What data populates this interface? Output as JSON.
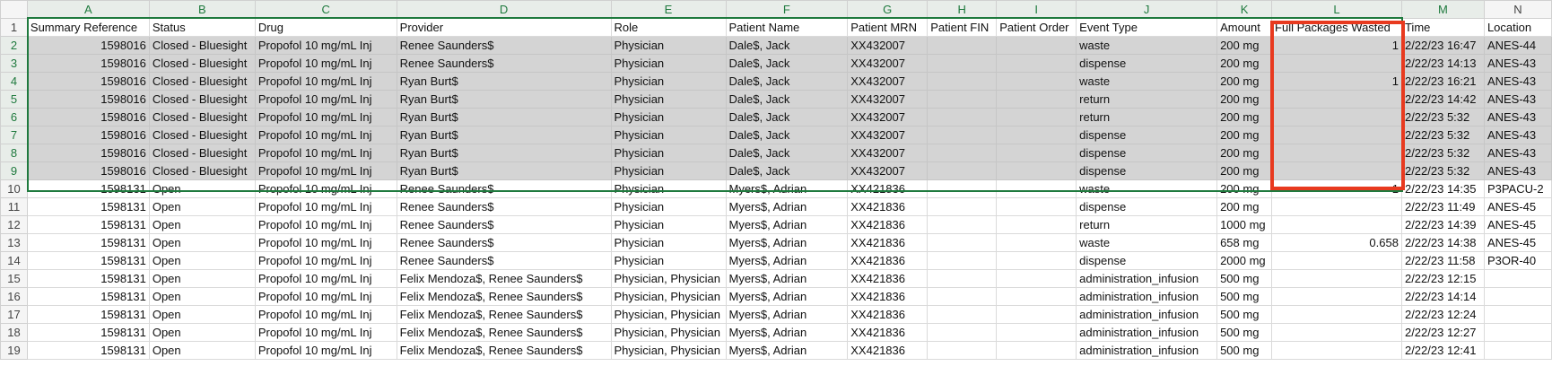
{
  "columns": [
    {
      "letter": "A",
      "num": false
    },
    {
      "letter": "B",
      "num": false
    },
    {
      "letter": "C",
      "num": false
    },
    {
      "letter": "D",
      "num": false
    },
    {
      "letter": "E",
      "num": false
    },
    {
      "letter": "F",
      "num": false
    },
    {
      "letter": "G",
      "num": false
    },
    {
      "letter": "H",
      "num": false
    },
    {
      "letter": "I",
      "num": false
    },
    {
      "letter": "J",
      "num": false
    },
    {
      "letter": "K",
      "num": false
    },
    {
      "letter": "L",
      "num": false
    },
    {
      "letter": "M",
      "num": false
    },
    {
      "letter": "N",
      "num": false
    }
  ],
  "header_row": [
    "Summary Reference",
    "Status",
    "Drug",
    "Provider",
    "Role",
    "Patient Name",
    "Patient MRN",
    "Patient FIN",
    "Patient Order",
    "Event Type",
    "Amount",
    "Full Packages Wasted",
    "Time",
    "Location"
  ],
  "rows": [
    {
      "n": "2",
      "cells": [
        "1598016",
        "Closed - Bluesight",
        "Propofol 10 mg/mL Inj",
        "Renee Saunders$",
        "Physician",
        "Dale$, Jack",
        "XX432007",
        "",
        "",
        "waste",
        "200 mg",
        "1",
        "2/22/23 16:47",
        "ANES-44"
      ]
    },
    {
      "n": "3",
      "cells": [
        "1598016",
        "Closed - Bluesight",
        "Propofol 10 mg/mL Inj",
        "Renee Saunders$",
        "Physician",
        "Dale$, Jack",
        "XX432007",
        "",
        "",
        "dispense",
        "200 mg",
        "",
        "2/22/23 14:13",
        "ANES-43"
      ]
    },
    {
      "n": "4",
      "cells": [
        "1598016",
        "Closed - Bluesight",
        "Propofol 10 mg/mL Inj",
        "Ryan Burt$",
        "Physician",
        "Dale$, Jack",
        "XX432007",
        "",
        "",
        "waste",
        "200 mg",
        "1",
        "2/22/23 16:21",
        "ANES-43"
      ]
    },
    {
      "n": "5",
      "cells": [
        "1598016",
        "Closed - Bluesight",
        "Propofol 10 mg/mL Inj",
        "Ryan Burt$",
        "Physician",
        "Dale$, Jack",
        "XX432007",
        "",
        "",
        "return",
        "200 mg",
        "",
        "2/22/23 14:42",
        "ANES-43"
      ]
    },
    {
      "n": "6",
      "cells": [
        "1598016",
        "Closed - Bluesight",
        "Propofol 10 mg/mL Inj",
        "Ryan Burt$",
        "Physician",
        "Dale$, Jack",
        "XX432007",
        "",
        "",
        "return",
        "200 mg",
        "",
        "2/22/23 5:32",
        "ANES-43"
      ]
    },
    {
      "n": "7",
      "cells": [
        "1598016",
        "Closed - Bluesight",
        "Propofol 10 mg/mL Inj",
        "Ryan Burt$",
        "Physician",
        "Dale$, Jack",
        "XX432007",
        "",
        "",
        "dispense",
        "200 mg",
        "",
        "2/22/23 5:32",
        "ANES-43"
      ]
    },
    {
      "n": "8",
      "cells": [
        "1598016",
        "Closed - Bluesight",
        "Propofol 10 mg/mL Inj",
        "Ryan Burt$",
        "Physician",
        "Dale$, Jack",
        "XX432007",
        "",
        "",
        "dispense",
        "200 mg",
        "",
        "2/22/23 5:32",
        "ANES-43"
      ]
    },
    {
      "n": "9",
      "cells": [
        "1598016",
        "Closed - Bluesight",
        "Propofol 10 mg/mL Inj",
        "Ryan Burt$",
        "Physician",
        "Dale$, Jack",
        "XX432007",
        "",
        "",
        "dispense",
        "200 mg",
        "",
        "2/22/23 5:32",
        "ANES-43"
      ]
    },
    {
      "n": "10",
      "cells": [
        "1598131",
        "Open",
        "Propofol 10 mg/mL Inj",
        "Renee Saunders$",
        "Physician",
        "Myers$, Adrian",
        "XX421836",
        "",
        "",
        "waste",
        "200 mg",
        "1",
        "2/22/23 14:35",
        "P3PACU-2"
      ]
    },
    {
      "n": "11",
      "cells": [
        "1598131",
        "Open",
        "Propofol 10 mg/mL Inj",
        "Renee Saunders$",
        "Physician",
        "Myers$, Adrian",
        "XX421836",
        "",
        "",
        "dispense",
        "200 mg",
        "",
        "2/22/23 11:49",
        "ANES-45"
      ]
    },
    {
      "n": "12",
      "cells": [
        "1598131",
        "Open",
        "Propofol 10 mg/mL Inj",
        "Renee Saunders$",
        "Physician",
        "Myers$, Adrian",
        "XX421836",
        "",
        "",
        "return",
        "1000 mg",
        "",
        "2/22/23 14:39",
        "ANES-45"
      ]
    },
    {
      "n": "13",
      "cells": [
        "1598131",
        "Open",
        "Propofol 10 mg/mL Inj",
        "Renee Saunders$",
        "Physician",
        "Myers$, Adrian",
        "XX421836",
        "",
        "",
        "waste",
        "658 mg",
        "0.658",
        "2/22/23 14:38",
        "ANES-45"
      ]
    },
    {
      "n": "14",
      "cells": [
        "1598131",
        "Open",
        "Propofol 10 mg/mL Inj",
        "Renee Saunders$",
        "Physician",
        "Myers$, Adrian",
        "XX421836",
        "",
        "",
        "dispense",
        "2000 mg",
        "",
        "2/22/23 11:58",
        "P3OR-40"
      ]
    },
    {
      "n": "15",
      "cells": [
        "1598131",
        "Open",
        "Propofol 10 mg/mL Inj",
        "Felix Mendoza$, Renee Saunders$",
        "Physician, Physician",
        "Myers$, Adrian",
        "XX421836",
        "",
        "",
        "administration_infusion",
        "500 mg",
        "",
        "2/22/23 12:15",
        ""
      ]
    },
    {
      "n": "16",
      "cells": [
        "1598131",
        "Open",
        "Propofol 10 mg/mL Inj",
        "Felix Mendoza$, Renee Saunders$",
        "Physician, Physician",
        "Myers$, Adrian",
        "XX421836",
        "",
        "",
        "administration_infusion",
        "500 mg",
        "",
        "2/22/23 14:14",
        ""
      ]
    },
    {
      "n": "17",
      "cells": [
        "1598131",
        "Open",
        "Propofol 10 mg/mL Inj",
        "Felix Mendoza$, Renee Saunders$",
        "Physician, Physician",
        "Myers$, Adrian",
        "XX421836",
        "",
        "",
        "administration_infusion",
        "500 mg",
        "",
        "2/22/23 12:24",
        ""
      ]
    },
    {
      "n": "18",
      "cells": [
        "1598131",
        "Open",
        "Propofol 10 mg/mL Inj",
        "Felix Mendoza$, Renee Saunders$",
        "Physician, Physician",
        "Myers$, Adrian",
        "XX421836",
        "",
        "",
        "administration_infusion",
        "500 mg",
        "",
        "2/22/23 12:27",
        ""
      ]
    },
    {
      "n": "19",
      "cells": [
        "1598131",
        "Open",
        "Propofol 10 mg/mL Inj",
        "Felix Mendoza$, Renee Saunders$",
        "Physician, Physician",
        "Myers$, Adrian",
        "XX421836",
        "",
        "",
        "administration_infusion",
        "500 mg",
        "",
        "2/22/23 12:41",
        ""
      ]
    }
  ],
  "selected_rows": [
    "2",
    "3",
    "4",
    "5",
    "6",
    "7",
    "8",
    "9"
  ],
  "header_row_number": "1",
  "colors": {
    "selection_border": "#1f7a3e",
    "selection_fill": "#d4d4d4",
    "annotation_box": "#e83a1f"
  }
}
